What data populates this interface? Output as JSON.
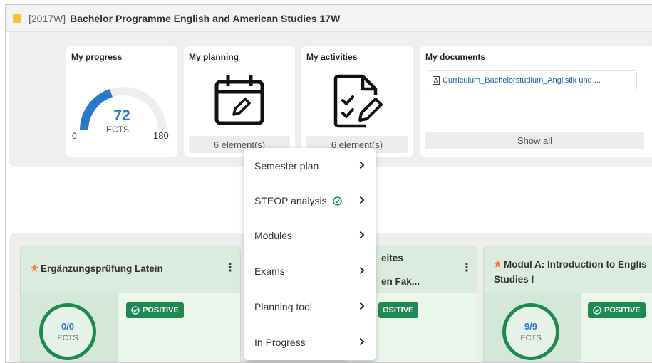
{
  "header": {
    "code": "[2017W]",
    "title": "Bachelor Programme English and American Studies 17W"
  },
  "progress": {
    "title": "My progress",
    "ects_value": "72",
    "ects_label": "ECTS",
    "min": "0",
    "max": "180",
    "fraction": 0.4
  },
  "planning": {
    "title": "My planning",
    "count_label": "6 element(s)"
  },
  "activities": {
    "title": "My activities",
    "count_label": "6 element(s)"
  },
  "documents": {
    "title": "My documents",
    "link": "Curriculum_Bachelorstudium_Anglistik und ...",
    "show_all": "Show all"
  },
  "modules": [
    {
      "title": "Ergänzungsprüfung Latein",
      "ects": "0/0",
      "ects_label": "ECTS",
      "badge": "POSITIVE"
    },
    {
      "title_line1": "eites",
      "title_line2": "en Fak...",
      "badge": "OSITIVE"
    },
    {
      "title_line1": "Modul A: Introduction to Englis",
      "title_line2": "Studies I",
      "ects": "9/9",
      "ects_label": "ECTS",
      "badge": "POSITIVE"
    }
  ],
  "menu": {
    "items": [
      {
        "label": "Semester plan"
      },
      {
        "label": "STEOP analysis"
      },
      {
        "label": "Modules"
      },
      {
        "label": "Exams"
      },
      {
        "label": "Planning tool"
      },
      {
        "label": "In Progress"
      }
    ]
  },
  "colors": {
    "accent_blue": "#2979c9",
    "positive_green": "#1f8a50",
    "header_square": "#f5c242",
    "status_star": "#f07f3c"
  }
}
